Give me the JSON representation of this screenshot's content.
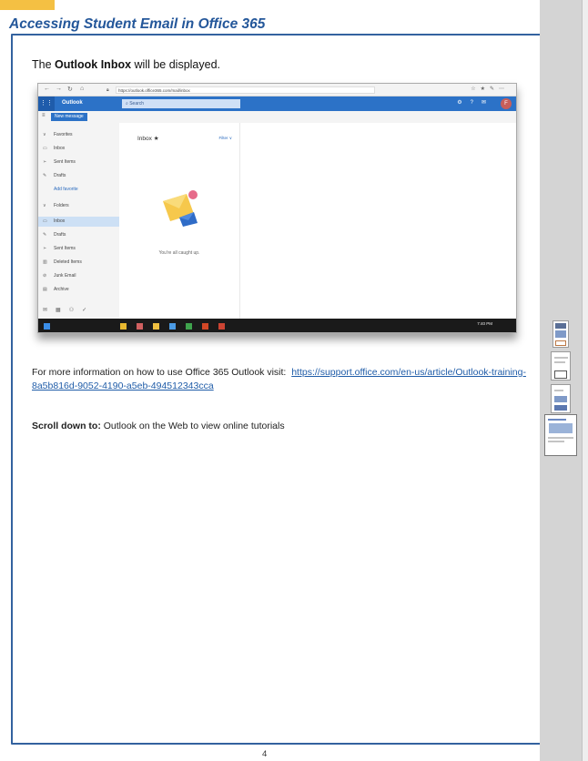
{
  "header": {
    "title": "Accessing Student Email in Office 365"
  },
  "lead": {
    "pre": "The ",
    "bold": "Outlook Inbox",
    "post": " will be displayed."
  },
  "screenshot": {
    "browser": {
      "url": "https://outlook.office365.com/mail/inbox"
    },
    "app": {
      "brand": "Outlook",
      "search_placeholder": "Search",
      "new_message": "New message",
      "avatar": "F"
    },
    "sidebar": [
      {
        "label": "Favorites",
        "icon": "chevron-icon"
      },
      {
        "label": "Inbox",
        "icon": "inbox-icon"
      },
      {
        "label": "Sent Items",
        "icon": "send-icon"
      },
      {
        "label": "Drafts",
        "icon": "pencil-icon"
      },
      {
        "label": "Add favorite",
        "icon": ""
      },
      {
        "label": "Folders",
        "icon": "chevron-icon"
      },
      {
        "label": "Inbox",
        "icon": "inbox-icon"
      },
      {
        "label": "Drafts",
        "icon": "pencil-icon"
      },
      {
        "label": "Sent Items",
        "icon": "send-icon"
      },
      {
        "label": "Deleted Items",
        "icon": "trash-icon"
      },
      {
        "label": "Junk Email",
        "icon": "block-icon"
      },
      {
        "label": "Archive",
        "icon": "archive-icon"
      }
    ],
    "list": {
      "heading": "Inbox ★",
      "filter": "Filter",
      "empty_message": "You're all caught up."
    },
    "taskbar": {
      "clock": "7:40 PM"
    }
  },
  "info": {
    "text": "For more information on how to use Office 365 Outlook visit:",
    "link": "https://support.office.com/en-us/article/Outlook-training-8a5b816d-9052-4190-a5eb-494512343cca"
  },
  "scroll": {
    "bold": "Scroll down to:",
    "text": " Outlook on the Web to view online tutorials"
  },
  "page_number": "4",
  "colors": {
    "header": "#24579a",
    "frame": "#33629f",
    "outlook_blue": "#2c72c7",
    "tab": "#f4c043"
  }
}
